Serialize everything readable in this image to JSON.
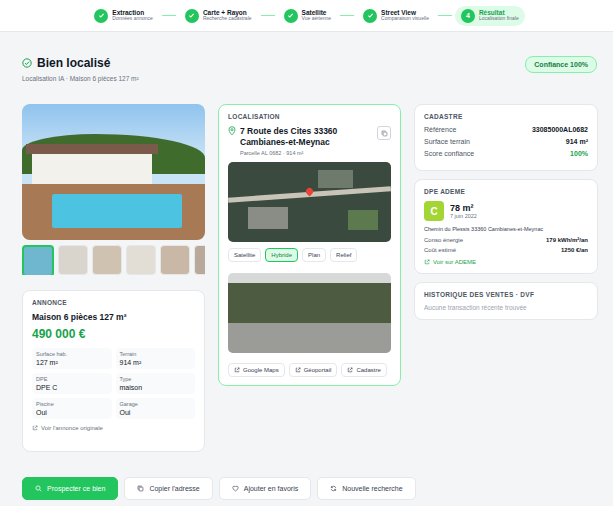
{
  "stepper": [
    {
      "title": "Extraction",
      "subtitle": "Données annonce",
      "done": true,
      "selected": false
    },
    {
      "title": "Carte + Rayon",
      "subtitle": "Recherche cadastrale",
      "done": true,
      "selected": false
    },
    {
      "title": "Satellite",
      "subtitle": "Vue aérienne",
      "done": true,
      "selected": false
    },
    {
      "title": "Street View",
      "subtitle": "Comparaison visuelle",
      "done": true,
      "selected": false
    },
    {
      "title": "Résultat",
      "subtitle": "Localisation finale",
      "number": "4",
      "done": false,
      "selected": true
    }
  ],
  "header": {
    "title": "Bien localisé",
    "subtitle": "Localisation IA · Maison 6 pièces 127 m²",
    "badge": "Confiance 100%"
  },
  "gallery": {
    "thumbnails": [
      {
        "selected": true
      },
      {
        "selected": false
      },
      {
        "selected": false
      },
      {
        "selected": false
      },
      {
        "selected": false
      },
      {
        "selected": false
      },
      {
        "selected": false
      }
    ]
  },
  "annonce": {
    "label": "ANNONCE",
    "title": "Maison 6 pièces 127 m²",
    "price": "490 000 €",
    "fields": [
      {
        "label": "Surface hab.",
        "value": "127 m²"
      },
      {
        "label": "Terrain",
        "value": "914 m²"
      },
      {
        "label": "DPE",
        "value": "DPE C"
      },
      {
        "label": "Type",
        "value": "maison"
      },
      {
        "label": "Piscine",
        "value": "Oui"
      },
      {
        "label": "Garage",
        "value": "Oui"
      }
    ],
    "link": "Voir l'annonce originale"
  },
  "localisation": {
    "label": "LOCALISATION",
    "address": "7 Route des Cites 33360 Cambianes-et-Meynac",
    "parcel": "Parcelle AL 0682 · 914 m²",
    "map_tabs": [
      {
        "label": "Satellite",
        "selected": false
      },
      {
        "label": "Hybride",
        "selected": true
      },
      {
        "label": "Plan",
        "selected": false
      },
      {
        "label": "Relief",
        "selected": false
      }
    ],
    "links": [
      "Google Maps",
      "Géoportail",
      "Cadastre"
    ]
  },
  "cadastre": {
    "label": "CADASTRE",
    "rows": [
      {
        "label": "Référence",
        "value": "33085000AL0682",
        "highlight": false
      },
      {
        "label": "Surface terrain",
        "value": "914 m²",
        "highlight": false
      },
      {
        "label": "Score confiance",
        "value": "100%",
        "highlight": true
      }
    ]
  },
  "dpe": {
    "label": "DPE ADEME",
    "grade": "C",
    "surface": "78 m²",
    "date": "7 juin 2022",
    "address": "Chemin du Plessis 33360 Cambianes-et-Meynac",
    "rows": [
      {
        "label": "Conso énergie",
        "value": "179 kWh/m²/an"
      },
      {
        "label": "Coût estimé",
        "value": "1250 €/an"
      }
    ],
    "link": "Voir sur ADEME"
  },
  "history": {
    "label": "HISTORIQUE DES VENTES · DVF",
    "empty": "Aucune transaction récente trouvée"
  },
  "actions": [
    {
      "label": "Prospecter ce bien",
      "primary": true
    },
    {
      "label": "Copier l'adresse",
      "primary": false
    },
    {
      "label": "Ajouter en favoris",
      "primary": false
    },
    {
      "label": "Nouvelle recherche",
      "primary": false
    }
  ]
}
